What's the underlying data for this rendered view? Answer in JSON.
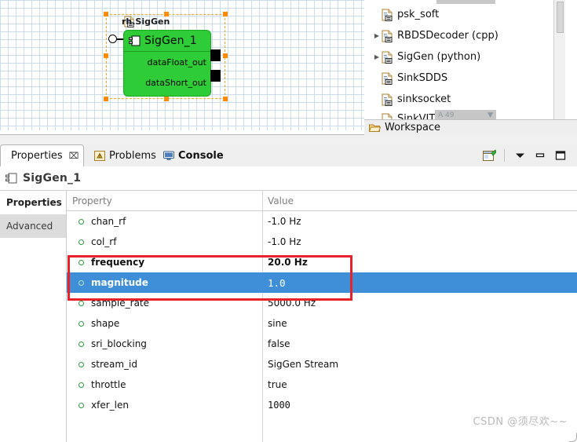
{
  "diagram": {
    "component_title": "rh.SigGen",
    "component_name": "SigGen_1",
    "ports": [
      "dataFloat_out",
      "dataShort_out"
    ],
    "title_icon": "document-component-icon",
    "name_icon": "component-icon",
    "input_port_icon": "input-port-circle-icon"
  },
  "tree": {
    "items": [
      {
        "label": "psk_soft",
        "expandable": false
      },
      {
        "label": "RBDSDecoder (cpp)",
        "expandable": true
      },
      {
        "label": "SigGen (python)",
        "expandable": true
      },
      {
        "label": "SinkSDDS",
        "expandable": false
      },
      {
        "label": "sinksocket",
        "expandable": false
      },
      {
        "label": "SinkVIT",
        "expandable": false
      }
    ],
    "overlay_value": "A 49",
    "workspace_label": "Workspace",
    "workspace_icon": "folder-open-icon"
  },
  "view_tabs": {
    "tabs": [
      {
        "label": "Properties",
        "icon": "properties-table-icon",
        "active": true,
        "closable": true
      },
      {
        "label": "Problems",
        "icon": "problems-warning-icon",
        "active": false,
        "closable": false
      },
      {
        "label": "Console",
        "icon": "console-monitor-icon",
        "active": false,
        "closable": false
      }
    ],
    "close_glyph": "⌧",
    "toolbar": [
      {
        "name": "new-properties-view-button",
        "icon": "new-view-icon"
      },
      {
        "name": "view-menu-button",
        "icon": "chevron-down-icon"
      },
      {
        "name": "minimize-button",
        "icon": "minimize-icon"
      },
      {
        "name": "maximize-button",
        "icon": "maximize-icon"
      }
    ]
  },
  "selection": {
    "title": "SigGen_1",
    "title_icon": "component-icon"
  },
  "side_tabs": [
    {
      "label": "Properties",
      "selected": true
    },
    {
      "label": "Advanced",
      "selected": false
    }
  ],
  "table": {
    "headers": {
      "property": "Property",
      "value": "Value"
    },
    "rows": [
      {
        "property": "chan_rf",
        "value": "-1.0 Hz",
        "bold": false,
        "selected": false,
        "mono": false
      },
      {
        "property": "col_rf",
        "value": "-1.0 Hz",
        "bold": false,
        "selected": false,
        "mono": false
      },
      {
        "property": "frequency",
        "value": "20.0 Hz",
        "bold": true,
        "selected": false,
        "mono": false
      },
      {
        "property": "magnitude",
        "value": "1.0",
        "bold": true,
        "selected": true,
        "mono": true
      },
      {
        "property": "sample_rate",
        "value": "5000.0 Hz",
        "bold": false,
        "selected": false,
        "mono": false
      },
      {
        "property": "shape",
        "value": "sine",
        "bold": false,
        "selected": false,
        "mono": false
      },
      {
        "property": "sri_blocking",
        "value": "false",
        "bold": false,
        "selected": false,
        "mono": false
      },
      {
        "property": "stream_id",
        "value": "SigGen Stream",
        "bold": false,
        "selected": false,
        "mono": false
      },
      {
        "property": "throttle",
        "value": "true",
        "bold": false,
        "selected": false,
        "mono": false
      },
      {
        "property": "xfer_len",
        "value": "1000",
        "bold": false,
        "selected": false,
        "mono": true
      }
    ]
  },
  "annotation": {
    "color": "#e8222b",
    "name": "highlight-box"
  },
  "watermark": {
    "text": "CSDN @须尽欢~~"
  },
  "colors": {
    "component_green": "#2ecc36",
    "selection_blue": "#3f8fd8",
    "selection_orange": "#ff8c00",
    "annotation_red": "#e8222b"
  }
}
